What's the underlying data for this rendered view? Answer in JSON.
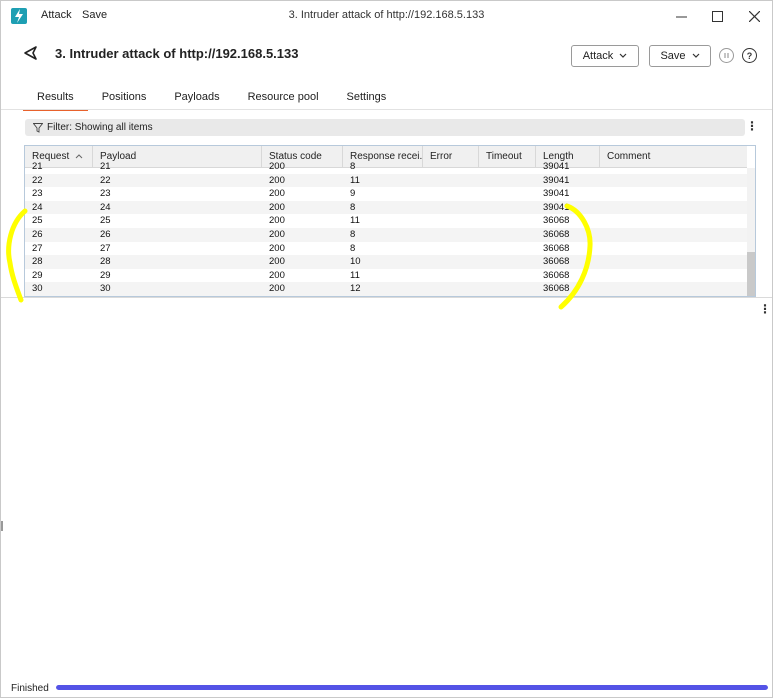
{
  "titlebar": {
    "menu": [
      "Attack",
      "Save"
    ],
    "title": "3. Intruder attack of http://192.168.5.133"
  },
  "header": {
    "title": "3. Intruder attack of http://192.168.5.133",
    "attack_button": "Attack",
    "save_button": "Save"
  },
  "tabs": [
    "Results",
    "Positions",
    "Payloads",
    "Resource pool",
    "Settings"
  ],
  "active_tab": "Results",
  "filter": {
    "text": "Filter: Showing all items"
  },
  "table": {
    "columns": [
      "Request",
      "Payload",
      "Status code",
      "Response recei...",
      "Error",
      "Timeout",
      "Length",
      "Comment"
    ],
    "partial_row": [
      "21",
      "21",
      "200",
      "8",
      "",
      "",
      "39041",
      ""
    ],
    "rows": [
      [
        "22",
        "22",
        "200",
        "11",
        "",
        "",
        "39041",
        ""
      ],
      [
        "23",
        "23",
        "200",
        "9",
        "",
        "",
        "39041",
        ""
      ],
      [
        "24",
        "24",
        "200",
        "8",
        "",
        "",
        "39041",
        ""
      ],
      [
        "25",
        "25",
        "200",
        "11",
        "",
        "",
        "36068",
        ""
      ],
      [
        "26",
        "26",
        "200",
        "8",
        "",
        "",
        "36068",
        ""
      ],
      [
        "27",
        "27",
        "200",
        "8",
        "",
        "",
        "36068",
        ""
      ],
      [
        "28",
        "28",
        "200",
        "10",
        "",
        "",
        "36068",
        ""
      ],
      [
        "29",
        "29",
        "200",
        "11",
        "",
        "",
        "36068",
        ""
      ],
      [
        "30",
        "30",
        "200",
        "12",
        "",
        "",
        "36068",
        ""
      ]
    ]
  },
  "status": {
    "text": "Finished",
    "progress": 1.0
  },
  "colors": {
    "accent": "#e8622c",
    "progress": "#5453e6",
    "annotation": "#ffff00",
    "app_icon": "#1e9fb3"
  }
}
